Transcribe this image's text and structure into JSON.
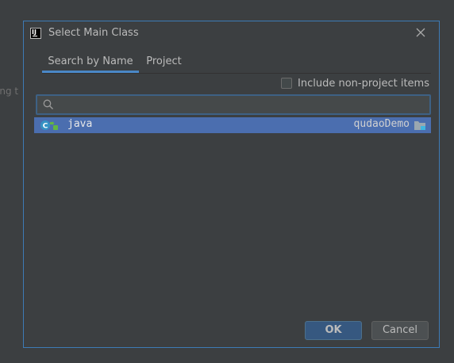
{
  "background": {
    "partial_text": "ing t"
  },
  "dialog": {
    "title": "Select Main Class",
    "app_icon_text": "IJ",
    "tabs": [
      {
        "label": "Search by Name",
        "active": true
      },
      {
        "label": "Project",
        "active": false
      }
    ],
    "include_non_project": {
      "label": "Include non-project items",
      "checked": false
    },
    "search": {
      "value": "",
      "placeholder": ""
    },
    "results": [
      {
        "name": "java",
        "module": "qudaoDemo",
        "icon": "class-icon",
        "selected": true
      }
    ],
    "buttons": {
      "ok": "OK",
      "cancel": "Cancel"
    }
  },
  "colors": {
    "background": "#3c3f41",
    "accent": "#4a88c7",
    "selection": "#4b6eaf",
    "dialog_border": "#3d7bb6",
    "ok_button": "#365880"
  }
}
